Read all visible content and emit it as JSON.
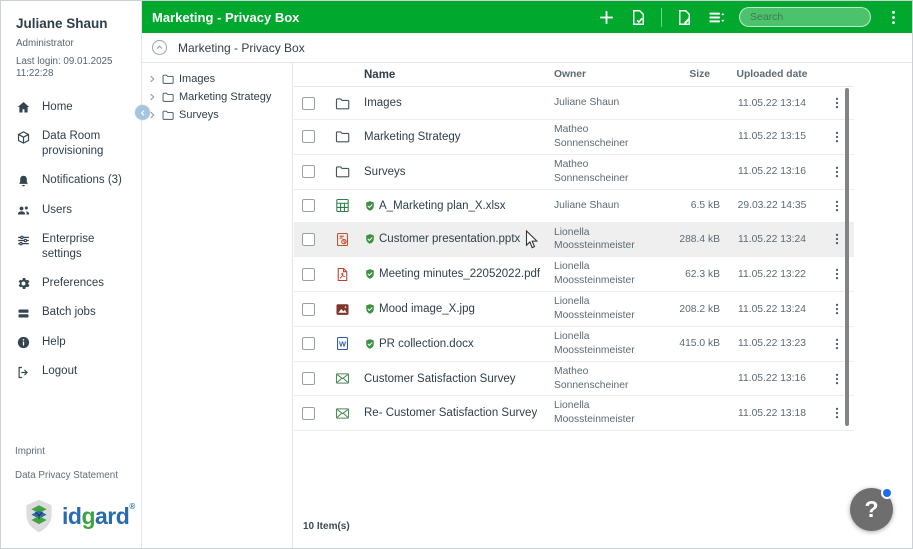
{
  "colors": {
    "accent_green": "#00a82e",
    "selected_row": "#efefef",
    "verified_green": "#3d9142",
    "help_badge_blue": "#1a6fe8",
    "logo_blue": "#2a6bb0",
    "logo_green": "#3fa344"
  },
  "sidebar": {
    "user": {
      "name": "Juliane Shaun",
      "role": "Administrator",
      "last_login": "Last login: 09.01.2025 11:22:28"
    },
    "nav": [
      {
        "icon": "home-icon",
        "label": "Home"
      },
      {
        "icon": "data-room-icon",
        "label": "Data Room provisioning"
      },
      {
        "icon": "bell-icon",
        "label": "Notifications (3)"
      },
      {
        "icon": "users-icon",
        "label": "Users"
      },
      {
        "icon": "sliders-icon",
        "label": "Enterprise settings"
      },
      {
        "icon": "gear-icon",
        "label": "Preferences"
      },
      {
        "icon": "batch-jobs-icon",
        "label": "Batch jobs"
      },
      {
        "icon": "info-icon",
        "label": "Help"
      },
      {
        "icon": "logout-icon",
        "label": "Logout"
      }
    ],
    "footer_links": [
      {
        "label": "Imprint"
      },
      {
        "label": "Data Privacy Statement"
      }
    ],
    "logo": {
      "parts": [
        {
          "text": "id",
          "color": "#2a6bb0"
        },
        {
          "text": "g",
          "color": "#3fa344"
        },
        {
          "text": "ard",
          "color": "#2a6bb0"
        }
      ],
      "trademark": "®"
    }
  },
  "header": {
    "title": "Marketing - Privacy Box",
    "tools": [
      "plus-icon",
      "file-check-icon",
      "file-edit-icon",
      "sort-list-icon",
      "kebab-icon"
    ],
    "search_placeholder": "Search",
    "search_value": ""
  },
  "breadcrumb": {
    "label": "Marketing - Privacy Box"
  },
  "tree": {
    "items": [
      {
        "icon": "folder-icon",
        "label": "Images"
      },
      {
        "icon": "folder-icon",
        "label": "Marketing Strategy"
      },
      {
        "icon": "folder-icon",
        "label": "Surveys"
      }
    ]
  },
  "table": {
    "columns": [
      "Name",
      "Owner",
      "Size",
      "Uploaded date"
    ],
    "rows": [
      {
        "icon": "folder-icon",
        "verified": false,
        "selected": false,
        "name": "Images",
        "owner": "Juliane Shaun",
        "size": "",
        "date": "11.05.22 13:14"
      },
      {
        "icon": "folder-icon",
        "verified": false,
        "selected": false,
        "name": "Marketing Strategy",
        "owner": "Matheo Sonnenscheiner",
        "size": "",
        "date": "11.05.22 13:15"
      },
      {
        "icon": "folder-icon",
        "verified": false,
        "selected": false,
        "name": "Surveys",
        "owner": "Matheo Sonnenscheiner",
        "size": "",
        "date": "11.05.22 13:16"
      },
      {
        "icon": "excel-icon",
        "verified": true,
        "selected": false,
        "name": "A_Marketing plan_X.xlsx",
        "owner": "Juliane Shaun",
        "size": "6.5 kB",
        "date": "29.03.22 14:35"
      },
      {
        "icon": "powerpoint-icon",
        "verified": true,
        "selected": true,
        "name": "Customer presentation.pptx",
        "owner": "Lionella Moossteinmeister",
        "size": "288.4 kB",
        "date": "11.05.22 13:24"
      },
      {
        "icon": "pdf-icon",
        "verified": true,
        "selected": false,
        "name": "Meeting minutes_22052022.pdf",
        "owner": "Lionella Moossteinmeister",
        "size": "62.3 kB",
        "date": "11.05.22 13:22"
      },
      {
        "icon": "image-icon",
        "verified": true,
        "selected": false,
        "name": "Mood image_X.jpg",
        "owner": "Lionella Moossteinmeister",
        "size": "208.2 kB",
        "date": "11.05.22 13:24"
      },
      {
        "icon": "word-icon",
        "verified": true,
        "selected": false,
        "name": "PR collection.docx",
        "owner": "Lionella Moossteinmeister",
        "size": "415.0 kB",
        "date": "11.05.22 13:23"
      },
      {
        "icon": "mail-icon",
        "verified": false,
        "selected": false,
        "name": "Customer Satisfaction Survey",
        "owner": "Matheo Sonnenscheiner",
        "size": "",
        "date": "11.05.22 13:16"
      },
      {
        "icon": "mail-icon",
        "verified": false,
        "selected": false,
        "name": "Re- Customer Satisfaction Survey",
        "owner": "Lionella Moossteinmeister",
        "size": "",
        "date": "11.05.22 13:18"
      }
    ],
    "footer": "10 Item(s)"
  },
  "help_button": {
    "label": "?"
  }
}
